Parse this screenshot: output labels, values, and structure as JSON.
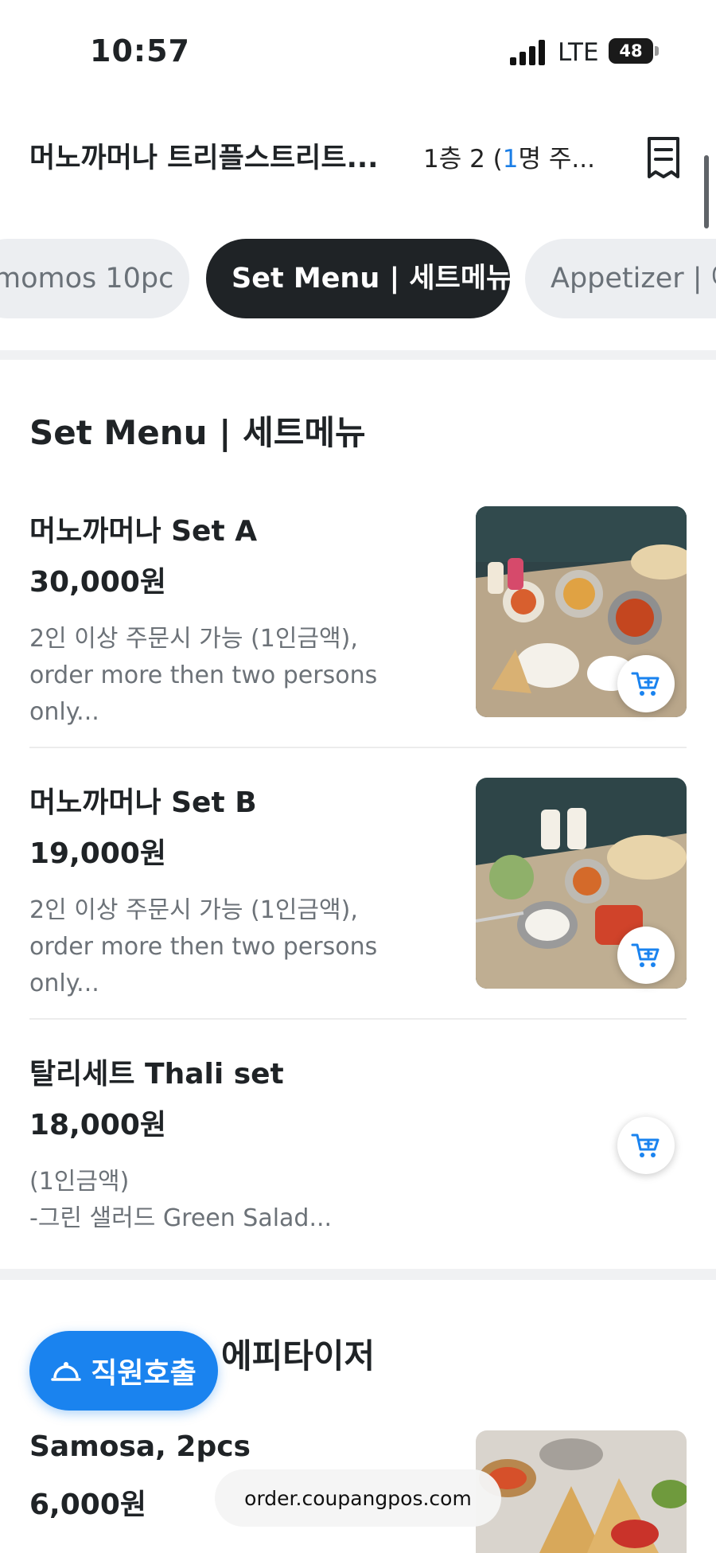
{
  "status_bar": {
    "time": "10:57",
    "network": "LTE",
    "battery": "48"
  },
  "header": {
    "store_name": "머노까머나 트리플스트리트...",
    "table_prefix": "1층 2 (",
    "table_count": "1",
    "table_suffix": "명 주..."
  },
  "tabs": [
    {
      "label": "momos 10pc",
      "active": false
    },
    {
      "label": "Set Menu | 세트메뉴",
      "active": true
    },
    {
      "label": "Appetizer | 에",
      "active": false
    }
  ],
  "sections": [
    {
      "title": "Set Menu | 세트메뉴",
      "items": [
        {
          "name": "머노까머나 Set A",
          "price": "30,000원",
          "desc": "2인 이상 주문시 가능 (1인금액), order more then two persons only..."
        },
        {
          "name": "머노까머나 Set B",
          "price": "19,000원",
          "desc": "2인 이상 주문시 가능 (1인금액), order more then two persons only..."
        },
        {
          "name": "탈리세트 Thali set",
          "price": "18,000원",
          "desc_line1": "(1인금액)",
          "desc_line2": "-그린 샐러드 Green Salad..."
        }
      ]
    },
    {
      "title_visible": "에피타이저",
      "items": [
        {
          "name": "Samosa, 2pcs",
          "price": "6,000원"
        }
      ]
    }
  ],
  "call_button": {
    "label": "직원호출"
  },
  "url_bar": {
    "text": "order.coupangpos.com"
  },
  "colors": {
    "accent": "#1a83ef",
    "dark": "#1f2326",
    "muted": "#6c7278"
  }
}
